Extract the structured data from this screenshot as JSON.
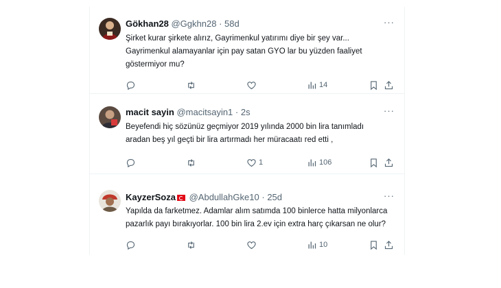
{
  "tweets": [
    {
      "name": "Gökhan28",
      "handle": "@Ggkhn28",
      "time": "58d",
      "flag": false,
      "lines": [
        "Şirket kurar şirkete alırız, Gayrimenkul yatırımı diye bir şey var...",
        "Gayrimenkul alamayanlar için pay satan GYO lar bu yüzden faaliyet",
        "göstermiyor mu?"
      ],
      "replies": "",
      "retweets": "",
      "likes": "",
      "views": "14"
    },
    {
      "name": "macit sayin",
      "handle": "@macitsayin1",
      "time": "2s",
      "flag": false,
      "lines": [
        "Beyefendi hiç sözünüz geçmiyor 2019 yılında 2000 bin lira tanımladı",
        "aradan beş yıl geçti bir lira artırmadı her müracaatı red etti ,"
      ],
      "replies": "",
      "retweets": "",
      "likes": "1",
      "views": "106"
    },
    {
      "name": "KayzerSoza",
      "handle": "@AbdullahGke10",
      "time": "25d",
      "flag": true,
      "lines": [
        "Yapılda da farketmez. Adamlar alım satımda 100 binlerce hatta milyonlarca",
        "pazarlık payı bırakıyorlar. 100 bin lira 2.ev için extra harç çıkarsan ne olur?"
      ],
      "replies": "",
      "retweets": "",
      "likes": "",
      "views": "10"
    }
  ],
  "icons": {
    "reply": "reply-icon",
    "retweet": "retweet-icon",
    "like": "heart-icon",
    "views": "views-icon",
    "bookmark": "bookmark-icon",
    "share": "share-icon",
    "more": "more-icon"
  },
  "more_label": "···",
  "colors": {
    "text": "#0f1419",
    "secondary": "#536471",
    "border": "#eff3f4"
  }
}
